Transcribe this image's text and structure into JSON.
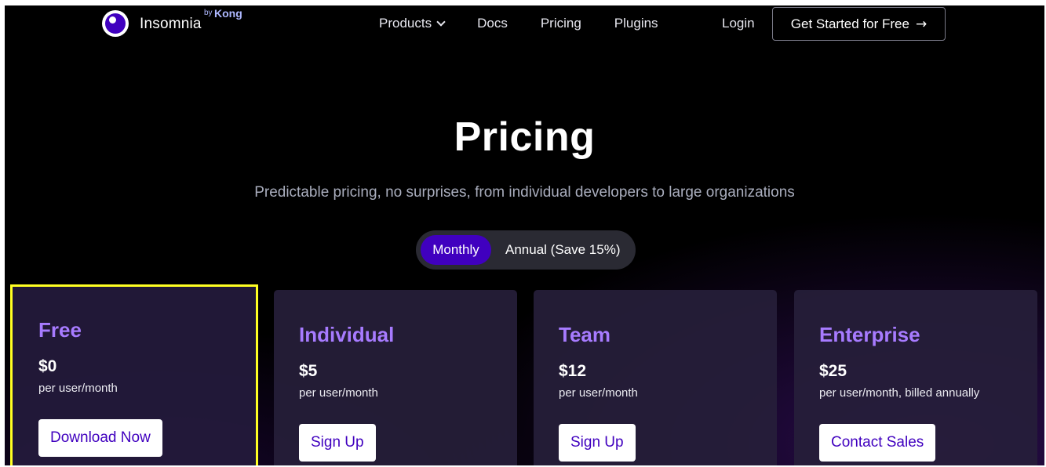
{
  "nav": {
    "logo_text": "Insomnia",
    "logo_by": "by",
    "logo_brand": "Kong",
    "links": [
      {
        "label": "Products",
        "has_dropdown": true
      },
      {
        "label": "Docs"
      },
      {
        "label": "Pricing"
      },
      {
        "label": "Plugins"
      }
    ],
    "login": "Login",
    "cta": "Get Started for Free",
    "cta_icon": "arrow-right-icon"
  },
  "hero": {
    "title": "Pricing",
    "subtitle": "Predictable pricing, no surprises, from individual developers to large organizations"
  },
  "billing_toggle": {
    "options": [
      "Monthly",
      "Annual (Save 15%)"
    ],
    "selected": "Monthly"
  },
  "plans": [
    {
      "name": "Free",
      "price": "$0",
      "period": "per user/month",
      "button": "Download Now",
      "highlighted": true
    },
    {
      "name": "Individual",
      "price": "$5",
      "period": "per user/month",
      "button": "Sign Up"
    },
    {
      "name": "Team",
      "price": "$12",
      "period": "per user/month",
      "button": "Sign Up"
    },
    {
      "name": "Enterprise",
      "price": "$25",
      "period": "per user/month, billed annually",
      "button": "Contact Sales"
    }
  ],
  "colors": {
    "accent": "#4000bf",
    "plan_name": "#a77bff",
    "highlight_border": "#ffff22",
    "background": "#000000"
  }
}
